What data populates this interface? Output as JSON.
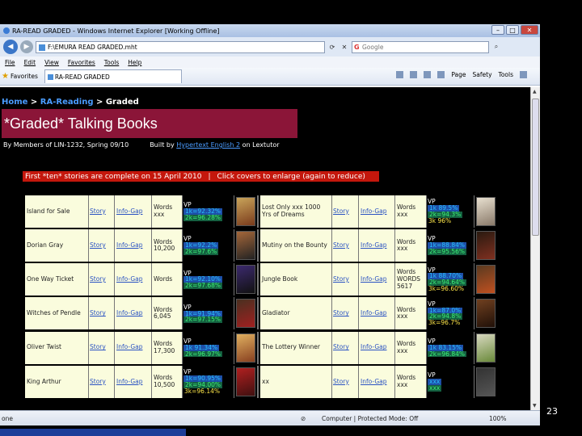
{
  "window": {
    "title": "RA-READ GRADED - Windows Internet Explorer [Working Offline]"
  },
  "address": {
    "url": "F:\\EMURA READ GRADED.mht",
    "search_placeholder": "Google"
  },
  "menu": [
    "File",
    "Edit",
    "View",
    "Favorites",
    "Tools",
    "Help"
  ],
  "favbar": {
    "label": "Favorites",
    "tab": "RA-READ GRADED",
    "tools": [
      "Page",
      "Safety",
      "Tools"
    ]
  },
  "page": {
    "breadcrumb": {
      "home": "Home",
      "sep1": " > ",
      "ra": "RA-Reading",
      "sep2": " > Graded"
    },
    "heading": "*Graded* Talking Books",
    "byline_left": "By Members of LIN-1232, Spring 09/10",
    "byline_built": "Built by",
    "byline_link": "Hypertext English 2",
    "byline_end": "on Lextutor",
    "notice_a": "First *ten* stories are complete on 15 April 2010",
    "notice_b": "Click covers to enlarge (again to reduce)",
    "left": [
      {
        "title": "Island for Sale",
        "story": "Story",
        "info": "Info-Gap",
        "words": "Words xxx",
        "vp": "VP",
        "k1": "1k=92.32%",
        "k2": "2k=96.28%",
        "k3": ""
      },
      {
        "title": "Dorian Gray",
        "story": "Story",
        "info": "Info-Gap",
        "words": "Words 10,200",
        "vp": "VP",
        "k1": "1k=92.2%",
        "k2": "2k=97.6%",
        "k3": ""
      },
      {
        "title": "One Way Ticket",
        "story": "Story",
        "info": "Info-Gap",
        "words": "Words",
        "vp": "VP",
        "k1": "1k=92.10%",
        "k2": "2k=97.68%",
        "k3": ""
      },
      {
        "title": "Witches of Pendle",
        "story": "Story",
        "info": "Info-Gap",
        "words": "Words 6,045",
        "vp": "VP",
        "k1": "1k=91.94%",
        "k2": "2k=97.15%",
        "k3": ""
      },
      {
        "title": "Oliver Twist",
        "story": "Story",
        "info": "Info-Gap",
        "words": "Words 17,300",
        "vp": "VP",
        "k1": "1k 91.34%",
        "k2": "2k=96.97%",
        "k3": ""
      },
      {
        "title": "King Arthur",
        "story": "Story",
        "info": "Info-Gap",
        "words": "Words 10,500",
        "vp": "VP",
        "k1": "1k=90.95%",
        "k2": "2k=94.00%",
        "k3": "3k=96.14%"
      }
    ],
    "right": [
      {
        "title": "Lost Only xxx 1000 Yrs of Dreams",
        "story": "Story",
        "info": "Info-Gap",
        "words": "Words xxx",
        "vp": "VP",
        "k1": "1k 89.5%",
        "k2": "2k=94.3%",
        "k3": "3k 96%"
      },
      {
        "title": "Mutiny on the Bounty",
        "story": "Story",
        "info": "Info-Gap",
        "words": "Words xxx",
        "vp": "VP",
        "k1": "1k=88.84%",
        "k2": "2k=95.56%",
        "k3": ""
      },
      {
        "title": "Jungle Book",
        "story": "Story",
        "info": "Info-Gap",
        "words": "Words WORDS 5617",
        "vp": "VP",
        "k1": "1k 88.70%",
        "k2": "2k=94.64%",
        "k3": "3k=96.60%"
      },
      {
        "title": "Gladiator",
        "story": "Story",
        "info": "Info-Gap",
        "words": "Words xxx",
        "vp": "VP",
        "k1": "1k=87.0%",
        "k2": "2k=94.8%",
        "k3": "3k=96.7%"
      },
      {
        "title": "The Lottery Winner",
        "story": "Story",
        "info": "Info-Gap",
        "words": "Words xxx",
        "vp": "VP",
        "k1": "1k 83.15%",
        "k2": "2k=96.84%",
        "k3": ""
      },
      {
        "title": "xx",
        "story": "Story",
        "info": "Info-Gap",
        "words": "Words xxx",
        "vp": "VP",
        "k1": "xxx",
        "k2": "xxx",
        "k3": ""
      }
    ]
  },
  "status": {
    "left": "one",
    "zone": "Computer | Protected Mode: Off",
    "zoom": "100%"
  },
  "slide_number": "23",
  "colors": {
    "heading_bg": "#8b1538",
    "notice_bg": "#c4170c",
    "cell_bg": "#fafcdd",
    "link": "#2a52c2"
  }
}
